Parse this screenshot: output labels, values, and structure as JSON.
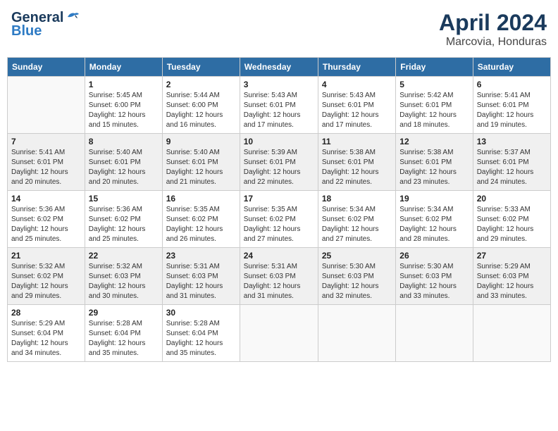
{
  "header": {
    "logo_general": "General",
    "logo_blue": "Blue",
    "month_title": "April 2024",
    "location": "Marcovia, Honduras"
  },
  "days_of_week": [
    "Sunday",
    "Monday",
    "Tuesday",
    "Wednesday",
    "Thursday",
    "Friday",
    "Saturday"
  ],
  "weeks": [
    [
      {
        "day": "",
        "info": ""
      },
      {
        "day": "1",
        "info": "Sunrise: 5:45 AM\nSunset: 6:00 PM\nDaylight: 12 hours\nand 15 minutes."
      },
      {
        "day": "2",
        "info": "Sunrise: 5:44 AM\nSunset: 6:00 PM\nDaylight: 12 hours\nand 16 minutes."
      },
      {
        "day": "3",
        "info": "Sunrise: 5:43 AM\nSunset: 6:01 PM\nDaylight: 12 hours\nand 17 minutes."
      },
      {
        "day": "4",
        "info": "Sunrise: 5:43 AM\nSunset: 6:01 PM\nDaylight: 12 hours\nand 17 minutes."
      },
      {
        "day": "5",
        "info": "Sunrise: 5:42 AM\nSunset: 6:01 PM\nDaylight: 12 hours\nand 18 minutes."
      },
      {
        "day": "6",
        "info": "Sunrise: 5:41 AM\nSunset: 6:01 PM\nDaylight: 12 hours\nand 19 minutes."
      }
    ],
    [
      {
        "day": "7",
        "info": "Sunrise: 5:41 AM\nSunset: 6:01 PM\nDaylight: 12 hours\nand 20 minutes."
      },
      {
        "day": "8",
        "info": "Sunrise: 5:40 AM\nSunset: 6:01 PM\nDaylight: 12 hours\nand 20 minutes."
      },
      {
        "day": "9",
        "info": "Sunrise: 5:40 AM\nSunset: 6:01 PM\nDaylight: 12 hours\nand 21 minutes."
      },
      {
        "day": "10",
        "info": "Sunrise: 5:39 AM\nSunset: 6:01 PM\nDaylight: 12 hours\nand 22 minutes."
      },
      {
        "day": "11",
        "info": "Sunrise: 5:38 AM\nSunset: 6:01 PM\nDaylight: 12 hours\nand 22 minutes."
      },
      {
        "day": "12",
        "info": "Sunrise: 5:38 AM\nSunset: 6:01 PM\nDaylight: 12 hours\nand 23 minutes."
      },
      {
        "day": "13",
        "info": "Sunrise: 5:37 AM\nSunset: 6:01 PM\nDaylight: 12 hours\nand 24 minutes."
      }
    ],
    [
      {
        "day": "14",
        "info": "Sunrise: 5:36 AM\nSunset: 6:02 PM\nDaylight: 12 hours\nand 25 minutes."
      },
      {
        "day": "15",
        "info": "Sunrise: 5:36 AM\nSunset: 6:02 PM\nDaylight: 12 hours\nand 25 minutes."
      },
      {
        "day": "16",
        "info": "Sunrise: 5:35 AM\nSunset: 6:02 PM\nDaylight: 12 hours\nand 26 minutes."
      },
      {
        "day": "17",
        "info": "Sunrise: 5:35 AM\nSunset: 6:02 PM\nDaylight: 12 hours\nand 27 minutes."
      },
      {
        "day": "18",
        "info": "Sunrise: 5:34 AM\nSunset: 6:02 PM\nDaylight: 12 hours\nand 27 minutes."
      },
      {
        "day": "19",
        "info": "Sunrise: 5:34 AM\nSunset: 6:02 PM\nDaylight: 12 hours\nand 28 minutes."
      },
      {
        "day": "20",
        "info": "Sunrise: 5:33 AM\nSunset: 6:02 PM\nDaylight: 12 hours\nand 29 minutes."
      }
    ],
    [
      {
        "day": "21",
        "info": "Sunrise: 5:32 AM\nSunset: 6:02 PM\nDaylight: 12 hours\nand 29 minutes."
      },
      {
        "day": "22",
        "info": "Sunrise: 5:32 AM\nSunset: 6:03 PM\nDaylight: 12 hours\nand 30 minutes."
      },
      {
        "day": "23",
        "info": "Sunrise: 5:31 AM\nSunset: 6:03 PM\nDaylight: 12 hours\nand 31 minutes."
      },
      {
        "day": "24",
        "info": "Sunrise: 5:31 AM\nSunset: 6:03 PM\nDaylight: 12 hours\nand 31 minutes."
      },
      {
        "day": "25",
        "info": "Sunrise: 5:30 AM\nSunset: 6:03 PM\nDaylight: 12 hours\nand 32 minutes."
      },
      {
        "day": "26",
        "info": "Sunrise: 5:30 AM\nSunset: 6:03 PM\nDaylight: 12 hours\nand 33 minutes."
      },
      {
        "day": "27",
        "info": "Sunrise: 5:29 AM\nSunset: 6:03 PM\nDaylight: 12 hours\nand 33 minutes."
      }
    ],
    [
      {
        "day": "28",
        "info": "Sunrise: 5:29 AM\nSunset: 6:04 PM\nDaylight: 12 hours\nand 34 minutes."
      },
      {
        "day": "29",
        "info": "Sunrise: 5:28 AM\nSunset: 6:04 PM\nDaylight: 12 hours\nand 35 minutes."
      },
      {
        "day": "30",
        "info": "Sunrise: 5:28 AM\nSunset: 6:04 PM\nDaylight: 12 hours\nand 35 minutes."
      },
      {
        "day": "",
        "info": ""
      },
      {
        "day": "",
        "info": ""
      },
      {
        "day": "",
        "info": ""
      },
      {
        "day": "",
        "info": ""
      }
    ]
  ]
}
